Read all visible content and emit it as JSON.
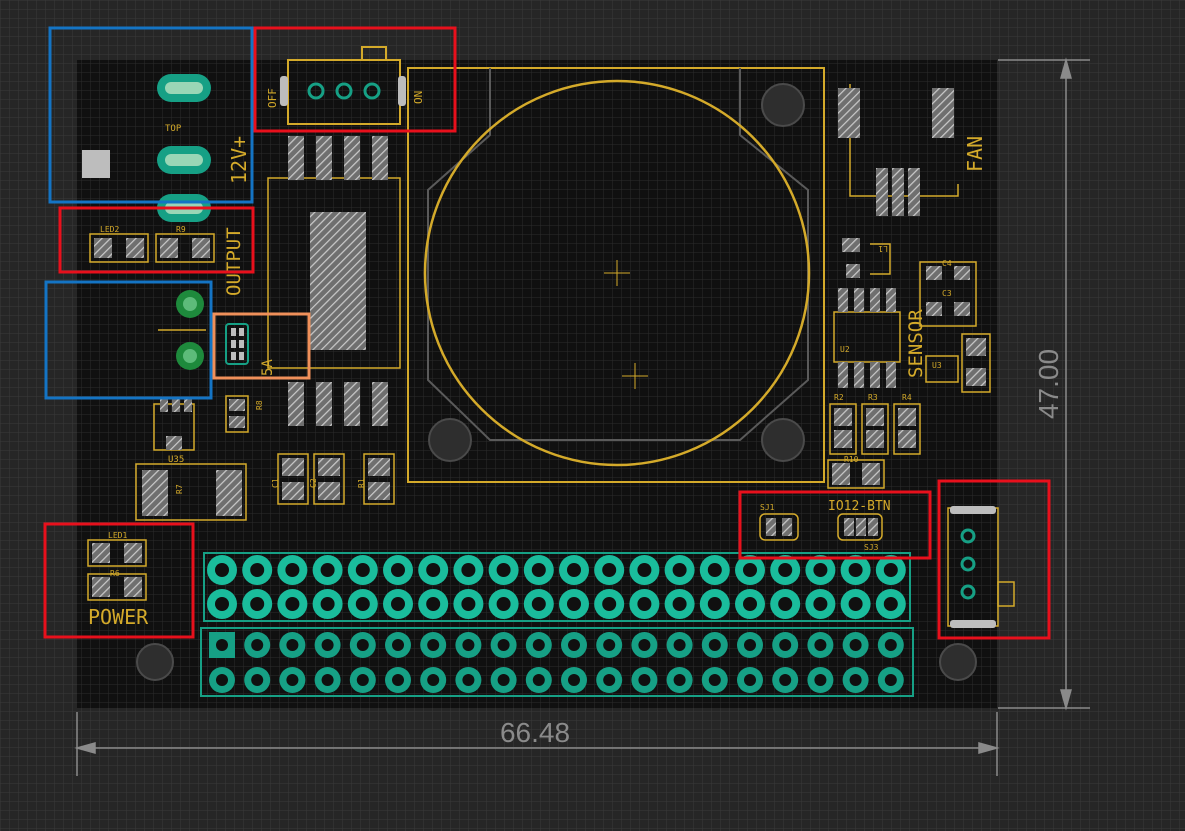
{
  "view": {
    "background": "#262626",
    "board_color": "#101010",
    "grid_color": "#3a3a3a",
    "silk_color": "#d4aa2a",
    "pad_color": "#16a085",
    "pad_color_top": "#1abc9c",
    "highlight_red": "#e8101c",
    "highlight_blue": "#1474c4",
    "highlight_orange": "#f0905a"
  },
  "dimensions": {
    "width": "66.48",
    "height": "47.00"
  },
  "silkscreen": {
    "top": "TOP",
    "v12": "12V+",
    "off": "OFF",
    "on": "ON",
    "fan": "FAN",
    "output": "OUTPUT",
    "sensor": "SENSOR",
    "power": "POWER",
    "io12_btn": "IO12-BTN",
    "led1": "LED1",
    "led2": "LED2",
    "r6": "R6",
    "r9": "R9",
    "r2": "R2",
    "r3": "R3",
    "r4": "R4",
    "r10": "R10",
    "r1": "R1",
    "r7": "R7",
    "r8": "R8",
    "c1": "C1",
    "c2": "C2",
    "c3": "C3",
    "c4": "C4",
    "u2": "U2",
    "u3": "U3",
    "u35": "U35",
    "sj1": "SJ1",
    "sj3": "SJ3",
    "l1": "L1",
    "jumper": "5A"
  }
}
